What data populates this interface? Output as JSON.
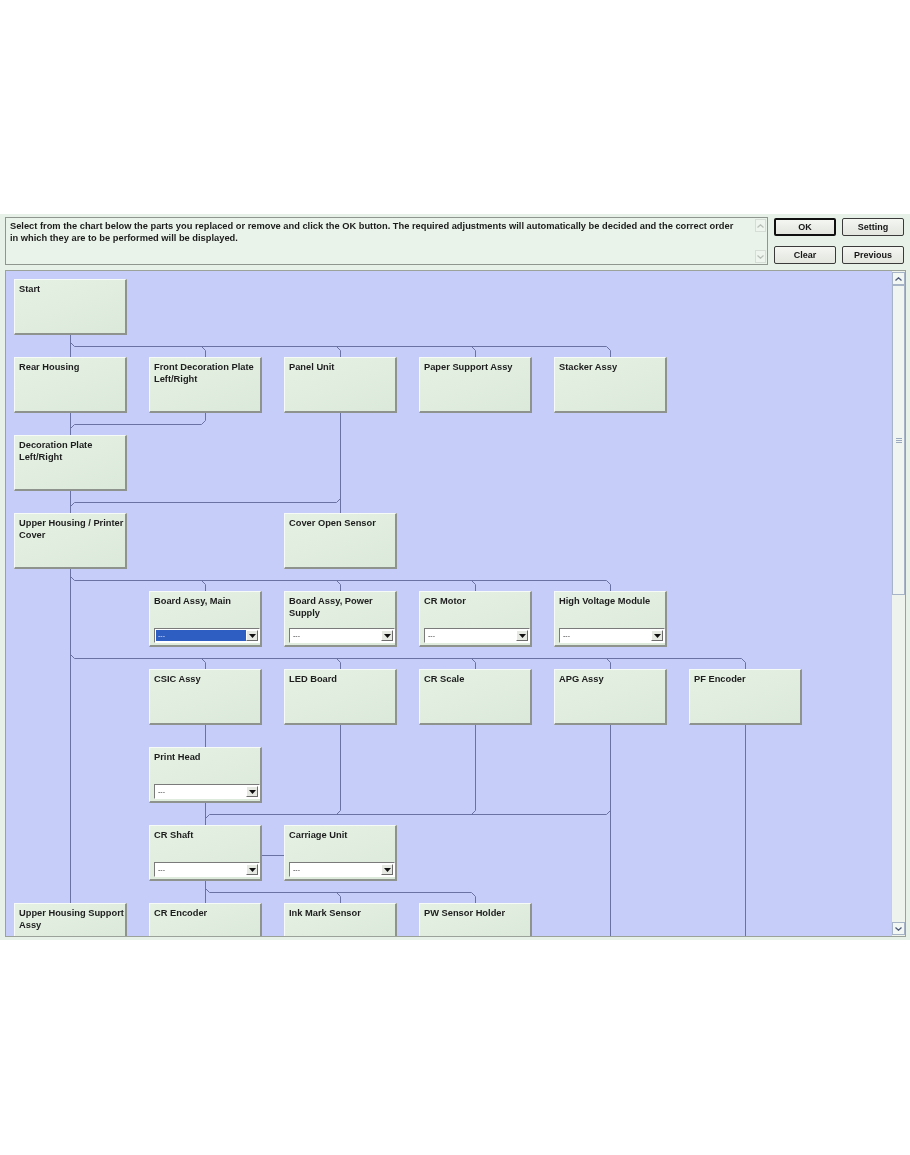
{
  "message": {
    "text": "Select from the chart below the parts you replaced or remove and click the OK button. The required adjustments will automatically be decided and the correct order in which they are to be performed will be displayed."
  },
  "buttons": [
    {
      "label": "OK",
      "default": true
    },
    {
      "label": "Setting",
      "default": false
    },
    {
      "label": "Clear",
      "default": false
    },
    {
      "label": "Previous",
      "default": false
    }
  ],
  "chart": {
    "nodes": [
      {
        "label": "Start"
      },
      {
        "label": "Rear Housing"
      },
      {
        "label": "Front Decoration Plate Left/Right"
      },
      {
        "label": "Panel Unit"
      },
      {
        "label": "Paper Support Assy"
      },
      {
        "label": "Stacker Assy"
      },
      {
        "label": "Decoration Plate Left/Right"
      },
      {
        "label": "Upper Housing / Printer Cover"
      },
      {
        "label": "Cover Open Sensor"
      },
      {
        "label": "Board Assy, Main",
        "dropdown": {
          "value": "---",
          "highlighted": true
        }
      },
      {
        "label": "Board Assy, Power Supply",
        "dropdown": {
          "value": "---",
          "highlighted": false
        }
      },
      {
        "label": "CR Motor",
        "dropdown": {
          "value": "---",
          "highlighted": false
        }
      },
      {
        "label": "High Voltage Module",
        "dropdown": {
          "value": "---",
          "highlighted": false
        }
      },
      {
        "label": "CSIC Assy"
      },
      {
        "label": "LED Board"
      },
      {
        "label": "CR Scale"
      },
      {
        "label": "APG Assy"
      },
      {
        "label": "PF Encoder"
      },
      {
        "label": "Print Head",
        "dropdown": {
          "value": "---",
          "highlighted": false
        }
      },
      {
        "label": "CR Shaft",
        "dropdown": {
          "value": "---",
          "highlighted": false
        }
      },
      {
        "label": "Carriage Unit",
        "dropdown": {
          "value": "---",
          "highlighted": false
        }
      },
      {
        "label": "Upper Housing Support Assy"
      },
      {
        "label": "CR Encoder"
      },
      {
        "label": "Ink Mark Sensor"
      },
      {
        "label": "PW Sensor Holder"
      }
    ]
  }
}
